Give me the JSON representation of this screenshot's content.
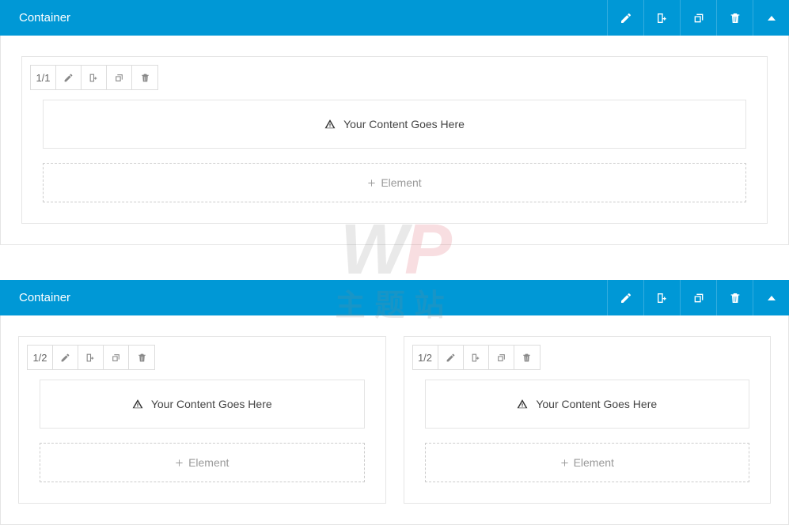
{
  "container": {
    "title": "Container"
  },
  "column": {
    "size_full": "1/1",
    "size_half": "1/2",
    "placeholder": "Your Content Goes Here",
    "add_element": "Element"
  },
  "watermark": {
    "logo_w": "W",
    "logo_p": "P",
    "subtitle": "主题站"
  }
}
